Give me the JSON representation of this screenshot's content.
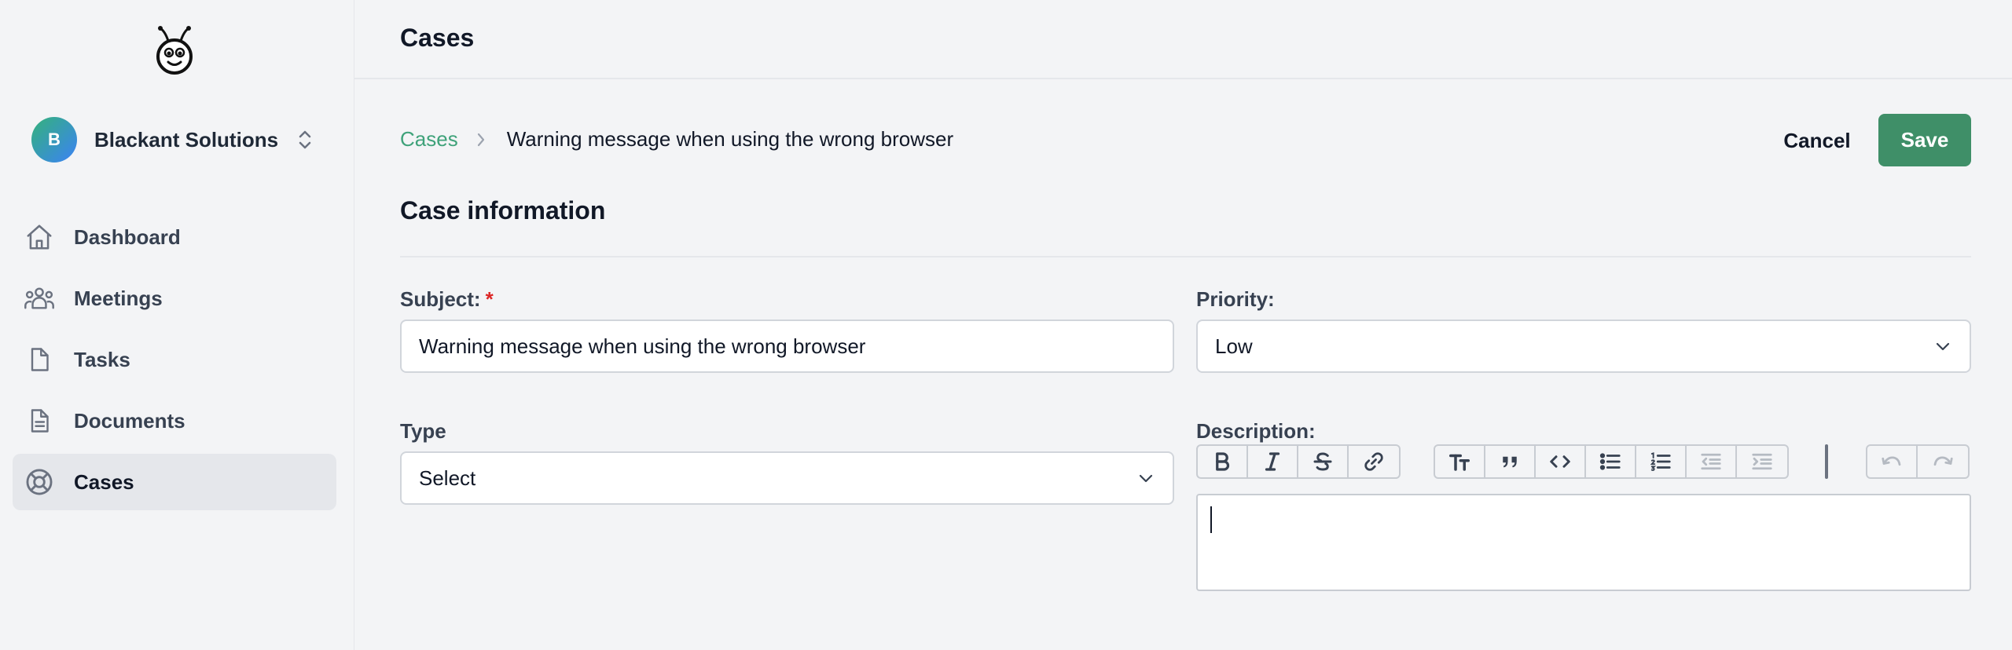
{
  "sidebar": {
    "org": {
      "initial": "B",
      "name": "Blackant Solutions"
    },
    "items": [
      {
        "label": "Dashboard",
        "icon": "home-icon",
        "active": false
      },
      {
        "label": "Meetings",
        "icon": "users-icon",
        "active": false
      },
      {
        "label": "Tasks",
        "icon": "file-icon",
        "active": false
      },
      {
        "label": "Documents",
        "icon": "document-icon",
        "active": false
      },
      {
        "label": "Cases",
        "icon": "lifebuoy-icon",
        "active": true
      }
    ]
  },
  "header": {
    "title": "Cases"
  },
  "breadcrumb": {
    "parent": "Cases",
    "current": "Warning message when using the wrong browser"
  },
  "actions": {
    "cancel_label": "Cancel",
    "save_label": "Save"
  },
  "section": {
    "title": "Case information"
  },
  "form": {
    "subject": {
      "label": "Subject:",
      "required_mark": "*",
      "value": "Warning message when using the wrong browser"
    },
    "priority": {
      "label": "Priority:",
      "value": "Low"
    },
    "type": {
      "label": "Type",
      "value": "Select"
    },
    "description": {
      "label": "Description:",
      "value": ""
    }
  },
  "toolbar": {
    "groups": [
      [
        "bold-icon",
        "italic-icon",
        "strikethrough-icon",
        "link-icon"
      ],
      [
        "heading-icon",
        "quote-icon",
        "code-icon",
        "bullet-list-icon",
        "numbered-list-icon",
        "outdent-icon",
        "indent-icon"
      ],
      [
        "undo-icon",
        "redo-icon"
      ]
    ]
  },
  "colors": {
    "accent": "#3f8f68",
    "link": "#3fa27a",
    "required": "#dc2626"
  }
}
